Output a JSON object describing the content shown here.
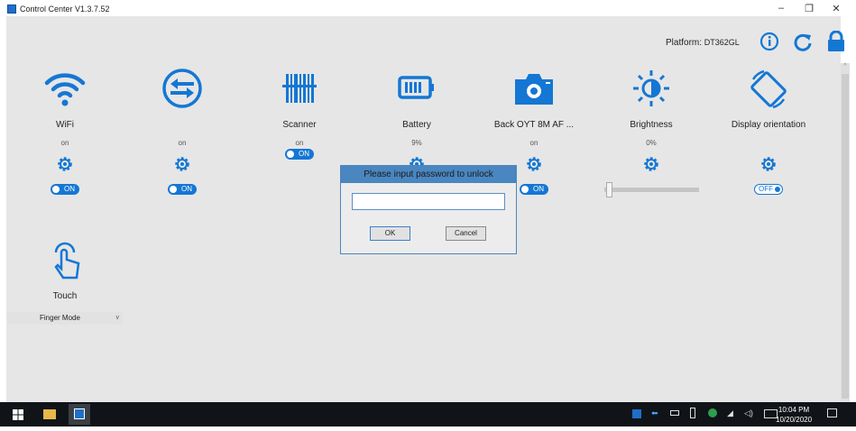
{
  "window": {
    "title": "Control Center V1.3.7.52",
    "minimize": "–",
    "restore": "❐",
    "close": "✕"
  },
  "header": {
    "platform_label": "Platform:",
    "platform_value": "DT362GL"
  },
  "tiles": [
    {
      "id": "wifi",
      "label": "WiFi",
      "status": "on",
      "toggle": "ON"
    },
    {
      "id": "sync",
      "label": "",
      "status": "on",
      "toggle": "ON"
    },
    {
      "id": "scanner",
      "label": "Scanner",
      "status": "on",
      "toggle": "ON"
    },
    {
      "id": "battery",
      "label": "Battery",
      "status": "9%"
    },
    {
      "id": "camera",
      "label": "Back OYT 8M AF ...",
      "status": "on",
      "toggle": "ON"
    },
    {
      "id": "brightness",
      "label": "Brightness",
      "status": "0%",
      "value_percent": 0
    },
    {
      "id": "orientation",
      "label": "Display orientation",
      "status": "",
      "toggle": "OFF"
    }
  ],
  "touch": {
    "label": "Touch",
    "mode": "Finger Mode"
  },
  "dialog": {
    "title": "Please input password to unlock",
    "password": "",
    "ok": "OK",
    "cancel": "Cancel"
  },
  "taskbar": {
    "time": "10:04 PM",
    "date": "10/20/2020"
  },
  "colors": {
    "accent": "#1477d4",
    "dialog_title": "#4a86c0"
  }
}
